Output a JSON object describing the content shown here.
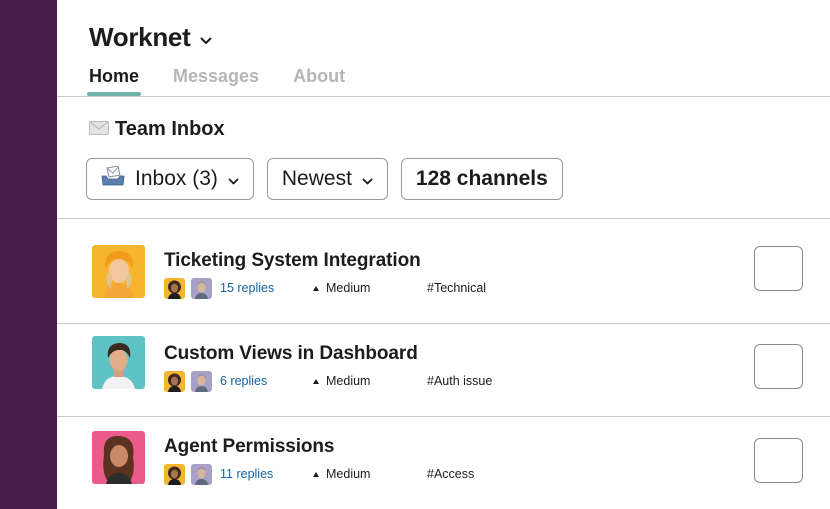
{
  "workspace": {
    "name": "Worknet"
  },
  "tabs": [
    {
      "label": "Home",
      "active": true
    },
    {
      "label": "Messages",
      "active": false
    },
    {
      "label": "About",
      "active": false
    }
  ],
  "section": {
    "title": "Team Inbox",
    "icon": "envelope-icon"
  },
  "filters": {
    "inbox_label": "Inbox (3)",
    "sort_label": "Newest",
    "channels_label": "128 channels"
  },
  "threads": [
    {
      "title": "Ticketing System Integration",
      "replies": "15 replies",
      "priority": "Medium",
      "tag": "#Technical"
    },
    {
      "title": "Custom Views in Dashboard",
      "replies": "6 replies",
      "priority": "Medium",
      "tag": "#Auth issue"
    },
    {
      "title": "Agent Permissions",
      "replies": "11 replies",
      "priority": "Medium",
      "tag": "#Access"
    }
  ],
  "colors": {
    "sidebar": "#4a1f4d",
    "tab_indicator": "#6fb3a9",
    "link": "#1264a3"
  }
}
